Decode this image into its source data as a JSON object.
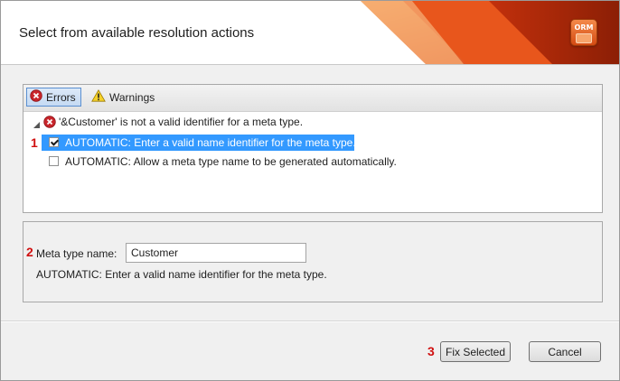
{
  "dialog": {
    "title": "Select from available resolution actions",
    "logo_text": "ORM"
  },
  "toolbar": {
    "errors_label": "Errors",
    "warnings_label": "Warnings"
  },
  "tree": {
    "error_message": "'&Customer' is not a valid identifier for a meta type.",
    "actions": [
      {
        "label": "AUTOMATIC: Enter a valid name identifier for the meta type.",
        "checked": true,
        "selected": true
      },
      {
        "label": "AUTOMATIC: Allow a meta type name to be generated automatically.",
        "checked": false,
        "selected": false
      }
    ]
  },
  "markers": [
    "1",
    "2",
    "3"
  ],
  "details": {
    "name_label": "Meta type name:",
    "name_value": "Customer",
    "description": "AUTOMATIC: Enter a valid name identifier for the meta type."
  },
  "buttons": {
    "fix_selected": "Fix Selected",
    "cancel": "Cancel"
  },
  "colors": {
    "selection": "#3399ff",
    "marker": "#d01010",
    "brand_orange": "#e8561c"
  }
}
